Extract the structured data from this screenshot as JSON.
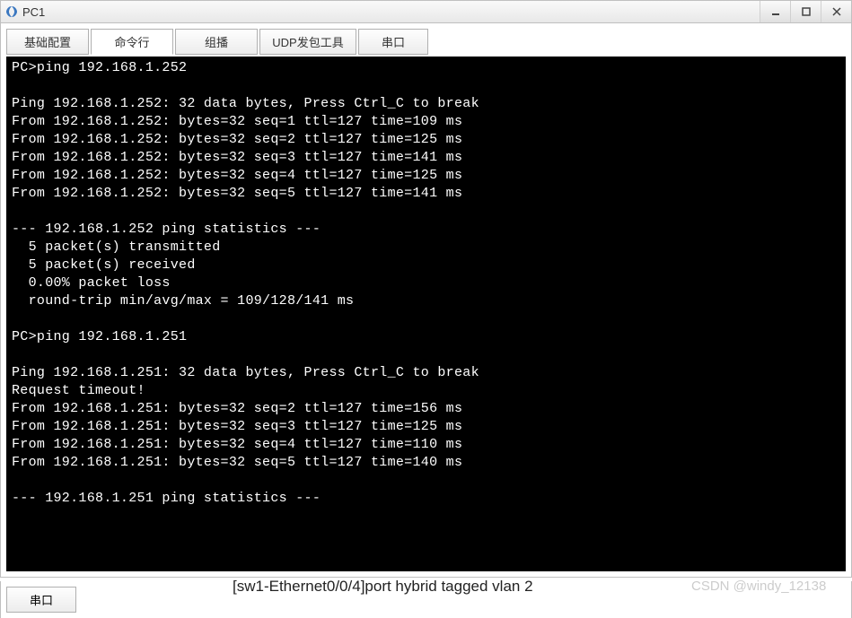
{
  "window": {
    "title": "PC1"
  },
  "tabs": {
    "t1": "基础配置",
    "t2": "命令行",
    "t3": "组播",
    "t4": "UDP发包工具",
    "t5": "串口"
  },
  "terminal_lines": [
    "PC>ping 192.168.1.252",
    "",
    "Ping 192.168.1.252: 32 data bytes, Press Ctrl_C to break",
    "From 192.168.1.252: bytes=32 seq=1 ttl=127 time=109 ms",
    "From 192.168.1.252: bytes=32 seq=2 ttl=127 time=125 ms",
    "From 192.168.1.252: bytes=32 seq=3 ttl=127 time=141 ms",
    "From 192.168.1.252: bytes=32 seq=4 ttl=127 time=125 ms",
    "From 192.168.1.252: bytes=32 seq=5 ttl=127 time=141 ms",
    "",
    "--- 192.168.1.252 ping statistics ---",
    "  5 packet(s) transmitted",
    "  5 packet(s) received",
    "  0.00% packet loss",
    "  round-trip min/avg/max = 109/128/141 ms",
    "",
    "PC>ping 192.168.1.251",
    "",
    "Ping 192.168.1.251: 32 data bytes, Press Ctrl_C to break",
    "Request timeout!",
    "From 192.168.1.251: bytes=32 seq=2 ttl=127 time=156 ms",
    "From 192.168.1.251: bytes=32 seq=3 ttl=127 time=125 ms",
    "From 192.168.1.251: bytes=32 seq=4 ttl=127 time=110 ms",
    "From 192.168.1.251: bytes=32 seq=5 ttl=127 time=140 ms",
    "",
    "--- 192.168.1.251 ping statistics ---"
  ],
  "bottom_tab": "串口",
  "overlay_command": "[sw1-Ethernet0/0/4]port hybrid  tagged  vlan 2",
  "watermark": "CSDN @windy_12138"
}
